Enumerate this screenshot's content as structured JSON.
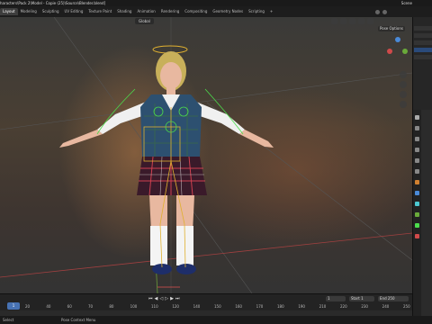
{
  "window": {
    "title": "haracters\\Pack 2\\Model - Copie (25)\\Source\\Blender.blend]",
    "scene_label": "Scene"
  },
  "workspace_tabs": [
    "Layout",
    "Modeling",
    "Sculpting",
    "UV Editing",
    "Texture Paint",
    "Shading",
    "Animation",
    "Rendering",
    "Compositing",
    "Geometry Nodes",
    "Scripting",
    "+"
  ],
  "active_tab_index": 0,
  "viewport": {
    "mode": "Global",
    "pose_options": "Pose Options"
  },
  "timeline": {
    "current_frame": "1",
    "start_label": "Start",
    "start_value": "1",
    "end_label": "End",
    "end_value": "250",
    "ruler": [
      "20",
      "40",
      "60",
      "70",
      "80",
      "100",
      "110",
      "120",
      "140",
      "150",
      "160",
      "170",
      "180",
      "190",
      "210",
      "220",
      "230",
      "240",
      "250"
    ],
    "playhead_label": "1"
  },
  "status": {
    "left": "Select",
    "mid": "Rotate View",
    "mid2": "Pose Context Menu"
  },
  "colors": {
    "accent": "#4772b3",
    "armature": "#e0b030",
    "bones_green": "#4cdc4c"
  }
}
